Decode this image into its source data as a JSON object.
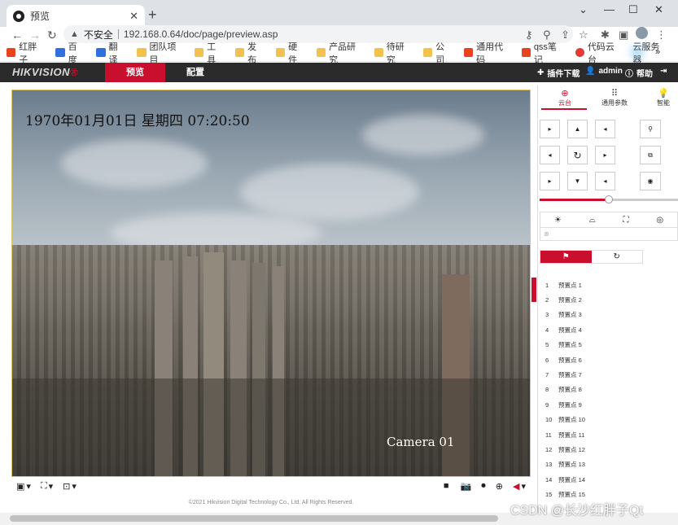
{
  "browser": {
    "tab_title": "预览",
    "new_tab_glyph": "+",
    "security_label": "不安全",
    "url": "192.168.0.64/doc/page/preview.asp",
    "bookmarks": [
      "红胖子",
      "百度",
      "翻译",
      "团队项目",
      "工具",
      "发布",
      "硬件",
      "产品研究",
      "待研究",
      "公司",
      "通用代码",
      "qss笔记",
      "代码云台",
      "云服务器"
    ],
    "bookmark_icons": [
      "red",
      "blue",
      "blue",
      "folder",
      "folder",
      "folder",
      "folder",
      "folder",
      "folder",
      "folder",
      "red",
      "red",
      "g",
      "cloud"
    ],
    "more_glyph": "»"
  },
  "app": {
    "brand": "HIKVISION",
    "nav": [
      "预览",
      "配置"
    ],
    "header_items": [
      "插件下载",
      "admin",
      "帮助"
    ]
  },
  "video": {
    "osd_time": "1970年01月01日 星期四 07:20:50",
    "camera_label": "Camera 01"
  },
  "footer": {
    "copyright": "©2021 Hikvision Digital Technology Co., Ltd. All Rights Reserved."
  },
  "panel": {
    "tabs": [
      "云台",
      "通用参数",
      "智能"
    ],
    "preset_tab_icons": [
      "flag-icon",
      "refresh-icon"
    ],
    "presets": [
      {
        "num": "1",
        "name": "预置点 1"
      },
      {
        "num": "2",
        "name": "预置点 2"
      },
      {
        "num": "3",
        "name": "预置点 3"
      },
      {
        "num": "4",
        "name": "预置点 4"
      },
      {
        "num": "5",
        "name": "预置点 5"
      },
      {
        "num": "6",
        "name": "预置点 6"
      },
      {
        "num": "7",
        "name": "预置点 7"
      },
      {
        "num": "8",
        "name": "预置点 8"
      },
      {
        "num": "9",
        "name": "预置点 9"
      },
      {
        "num": "10",
        "name": "预置点 10"
      },
      {
        "num": "11",
        "name": "预置点 11"
      },
      {
        "num": "12",
        "name": "预置点 12"
      },
      {
        "num": "13",
        "name": "预置点 13"
      },
      {
        "num": "14",
        "name": "预置点 14"
      },
      {
        "num": "15",
        "name": "预置点 15"
      }
    ],
    "speed_level": 0.5
  },
  "watermark": "CSDN @长沙红胖子Qt",
  "colors": {
    "brand_red": "#c8102e",
    "header_dark": "#2b2b2b"
  }
}
